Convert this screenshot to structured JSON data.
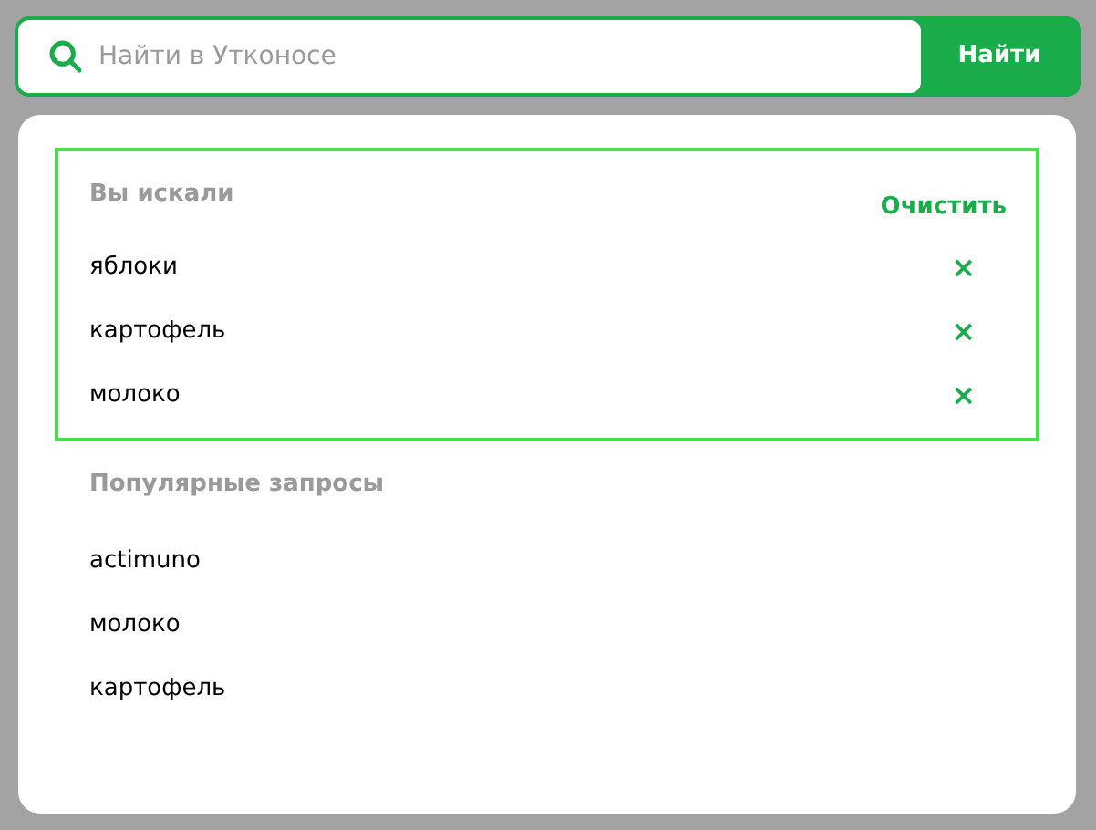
{
  "search": {
    "placeholder": "Найти в Утконосе",
    "button": "Найти"
  },
  "history": {
    "title": "Вы искали",
    "clear": "Очистить",
    "highlighted": true,
    "items": [
      {
        "text": "яблоки",
        "remove": "×"
      },
      {
        "text": "картофель",
        "remove": "×"
      },
      {
        "text": "молоко",
        "remove": "×"
      }
    ]
  },
  "popular": {
    "title": "Популярные запросы",
    "items": [
      "actimuno",
      "молоко",
      "картофель"
    ]
  }
}
